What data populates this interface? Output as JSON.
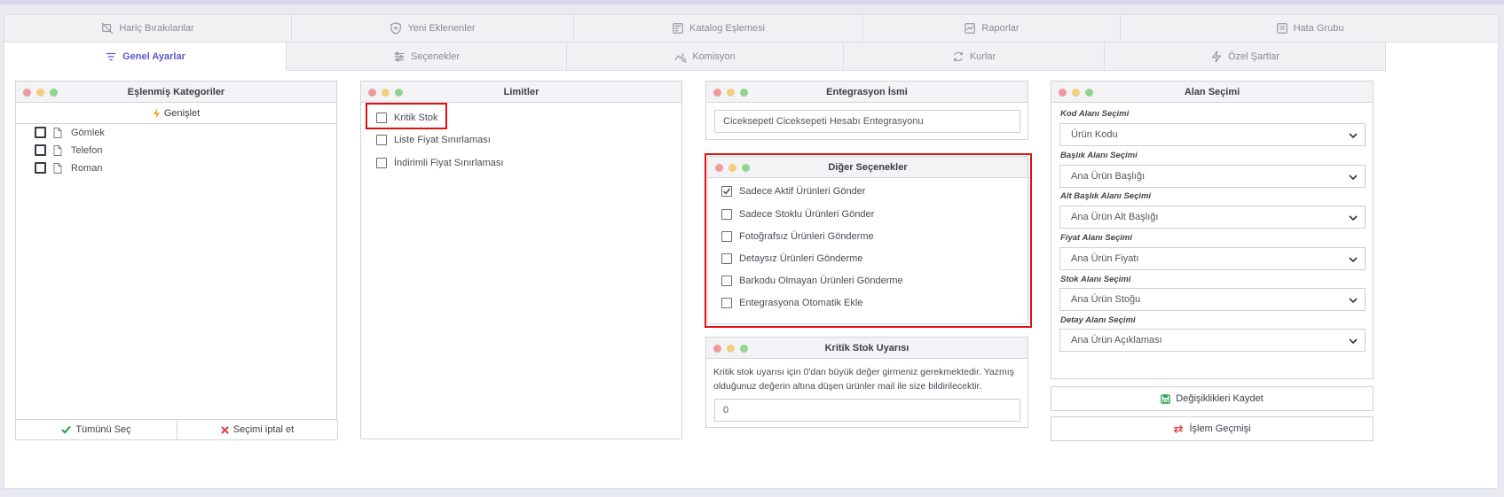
{
  "tabs_row1": [
    {
      "label": "Hariç Bırakılanlar",
      "icon": "eye-off-icon"
    },
    {
      "label": "Yeni Eklenenler",
      "icon": "plus-shield-icon"
    },
    {
      "label": "Katalog Eşlemesi",
      "icon": "catalog-icon"
    },
    {
      "label": "Raporlar",
      "icon": "report-icon"
    },
    {
      "label": "Hata Grubu",
      "icon": "error-box-icon"
    }
  ],
  "tabs_row2": [
    {
      "label": "Genel Ayarlar",
      "icon": "filter-lines-icon",
      "active": true
    },
    {
      "label": "Seçenekler",
      "icon": "sliders-icon"
    },
    {
      "label": "Komisyon",
      "icon": "chart-search-icon"
    },
    {
      "label": "Kurlar",
      "icon": "currency-exchange-icon"
    },
    {
      "label": "Özel Şartlar",
      "icon": "bolt-icon"
    }
  ],
  "categories": {
    "title": "Eşlenmiş Kategoriler",
    "expand_label": "Genişlet",
    "items": [
      "Gömlek",
      "Telefon",
      "Roman"
    ],
    "select_all": "Tümünü Seç",
    "cancel_select": "Seçimi iptal et"
  },
  "limits": {
    "title": "Limitler",
    "items": [
      "Kritik Stok",
      "Liste Fiyat Sınırlaması",
      "İndirimli Fiyat Sınırlaması"
    ]
  },
  "integration": {
    "title": "Entegrasyon İsmi",
    "value": "Ciceksepeti Ciceksepeti Hesabı Entegrasyonu"
  },
  "other_options": {
    "title": "Diğer Seçenekler",
    "items": [
      {
        "label": "Sadece Aktif Ürünleri Gönder",
        "checked": true
      },
      {
        "label": "Sadece Stoklu Ürünleri Gönder",
        "checked": false
      },
      {
        "label": "Fotoğrafsız Ürünleri Gönderme",
        "checked": false
      },
      {
        "label": "Detaysız Ürünleri Gönderme",
        "checked": false
      },
      {
        "label": "Barkodu Olmayan Ürünleri Gönderme",
        "checked": false
      },
      {
        "label": "Entegrasyona Otomatik Ekle",
        "checked": false
      }
    ]
  },
  "critical_stock": {
    "title": "Kritik Stok Uyarısı",
    "note": "Kritik stok uyarısı için 0'dan büyük değer girmeniz gerekmektedir. Yazmış olduğunuz değerin altına düşen ürünler mail ile size bildirilecektir.",
    "value": "0"
  },
  "field_selection": {
    "title": "Alan Seçimi",
    "fields": [
      {
        "label": "Kod Alanı Seçimi",
        "value": "Ürün Kodu"
      },
      {
        "label": "Başlık Alanı Seçimi",
        "value": "Ana Ürün Başlığı"
      },
      {
        "label": "Alt Başlık Alanı Seçimi",
        "value": "Ana Ürün Alt Başlığı"
      },
      {
        "label": "Fiyat Alanı Seçimi",
        "value": "Ana Ürün Fiyatı"
      },
      {
        "label": "Stok Alanı Seçimi",
        "value": "Ana Ürün Stoğu"
      },
      {
        "label": "Detay Alanı Seçimi",
        "value": "Ana Ürün Açıklaması"
      }
    ]
  },
  "actions": {
    "save": "Değişiklikleri Kaydet",
    "history": "İşlem Geçmişi"
  },
  "colors": {
    "accent": "#5a5acb",
    "highlight": "#e01010",
    "check_green": "#2aa24a",
    "cross_red": "#e03a3a"
  }
}
